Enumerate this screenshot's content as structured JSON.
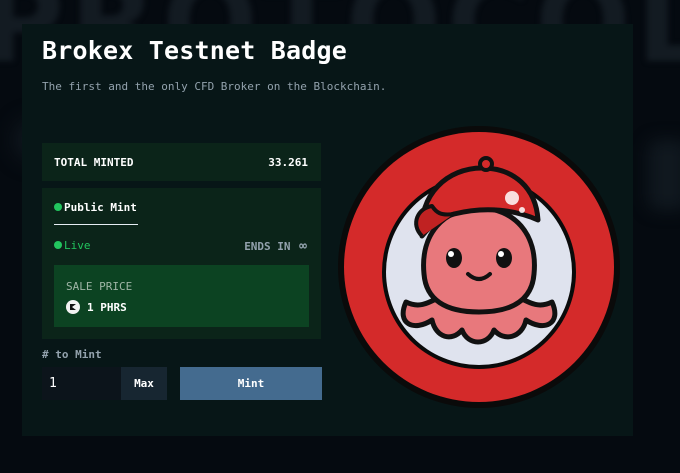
{
  "background": {
    "word": "PROTOCOL"
  },
  "header": {
    "title": "Brokex Testnet Badge",
    "subtitle": "The first and the only CFD Broker on the Blockchain."
  },
  "stats": {
    "total_minted_label": "TOTAL MINTED",
    "total_minted_value": "33.261"
  },
  "mint_card": {
    "tab_label": "Public Mint",
    "status_label": "Live",
    "ends_label": "ENDS IN",
    "ends_value": "∞",
    "sale_price_label": "SALE PRICE",
    "sale_price_value": "1 PHRS"
  },
  "mint_form": {
    "quantity_label": "# to Mint",
    "quantity_value": "1",
    "max_label": "Max",
    "mint_label": "Mint"
  },
  "colors": {
    "accent_green": "#22c55e",
    "card_bg": "#0b2419",
    "sale_bg": "#0c4322",
    "mint_button": "#446b8f",
    "badge_red": "#d42a2a"
  },
  "badge": {
    "icon": "octopus-with-red-cap-icon"
  }
}
